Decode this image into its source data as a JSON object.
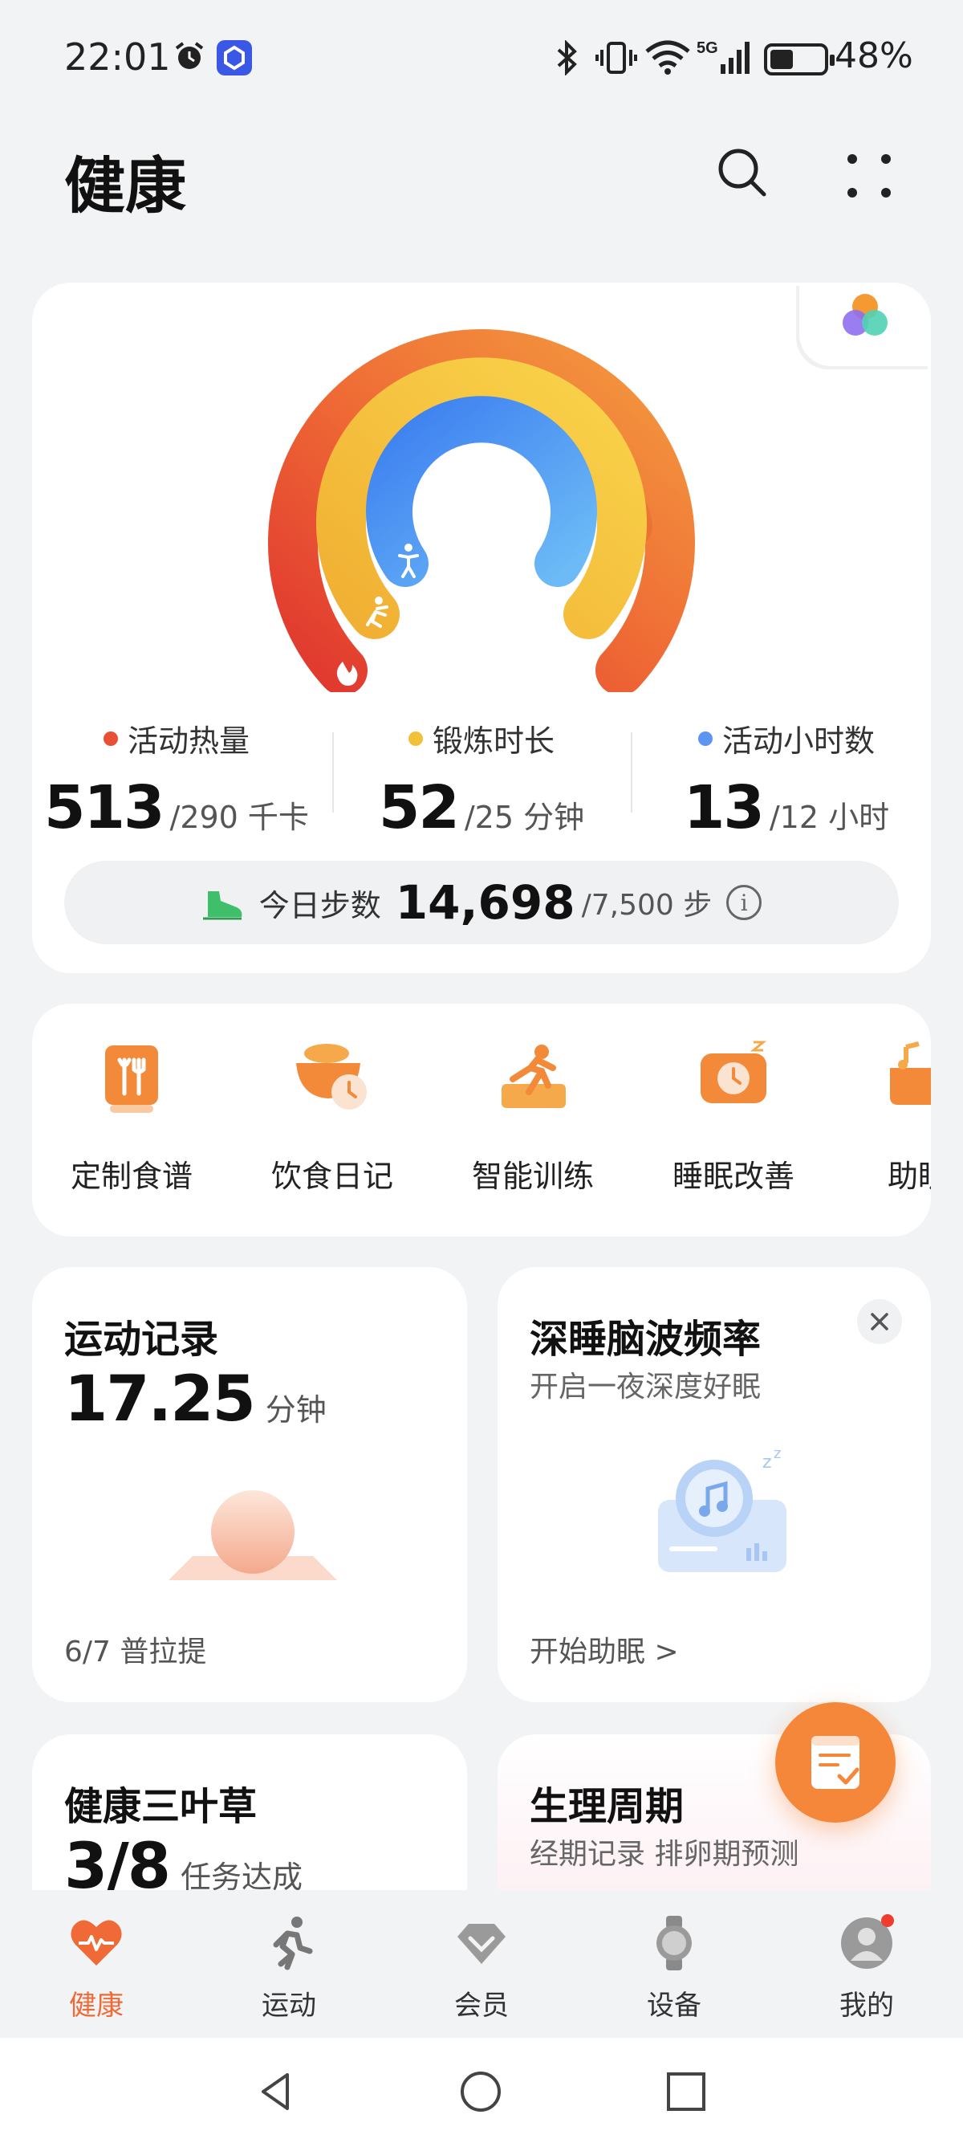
{
  "status_bar": {
    "time": "22:01",
    "network": "5G",
    "battery": "48%"
  },
  "header": {
    "title": "健康"
  },
  "rings": {
    "metrics": [
      {
        "label": "活动热量",
        "value": "513",
        "target": "/290 千卡",
        "color": "#e94f33"
      },
      {
        "label": "锻炼时长",
        "value": "52",
        "target": "/25 分钟",
        "color": "#f3c03a"
      },
      {
        "label": "活动小时数",
        "value": "13",
        "target": "/12 小时",
        "color": "#5b95f0"
      }
    ],
    "steps": {
      "label": "今日步数",
      "value": "14,698",
      "target": "/7,500 步"
    }
  },
  "shortcuts": [
    {
      "label": "定制食谱"
    },
    {
      "label": "饮食日记"
    },
    {
      "label": "智能训练"
    },
    {
      "label": "睡眠改善"
    },
    {
      "label": "助眠"
    }
  ],
  "tiles": {
    "exercise": {
      "title": "运动记录",
      "value": "17.25",
      "unit": "分钟",
      "footer": "6/7   普拉提"
    },
    "brainwave": {
      "title": "深睡脑波频率",
      "subtitle": "开启一夜深度好眠",
      "footer": "开始助眠 >"
    },
    "clover": {
      "title": "健康三叶草",
      "value": "3/8",
      "unit": "任务达成"
    },
    "cycle": {
      "title": "生理周期",
      "subtitle": "经期记录 排卵期预测"
    }
  },
  "bottom_nav": [
    {
      "label": "健康",
      "active": true
    },
    {
      "label": "运动"
    },
    {
      "label": "会员"
    },
    {
      "label": "设备"
    },
    {
      "label": "我的"
    }
  ],
  "colors": {
    "accent": "#ef6a36",
    "ring_outer": "#e94f33",
    "ring_middle": "#f3c03a",
    "ring_inner": "#5b95f0"
  }
}
